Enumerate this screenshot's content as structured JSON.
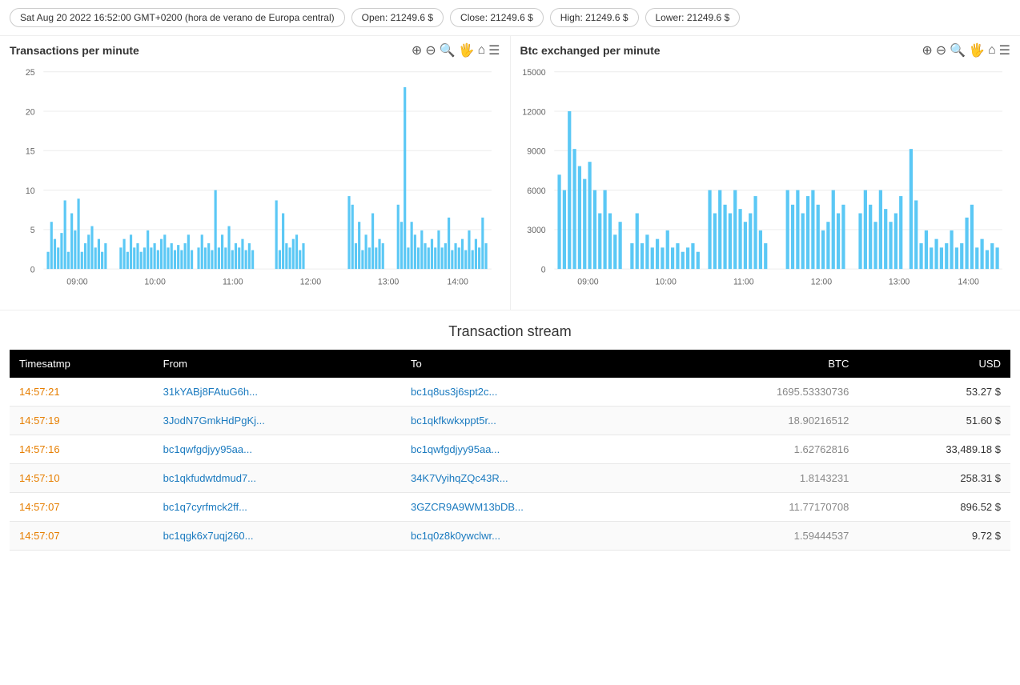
{
  "topBar": {
    "datetime": "Sat Aug 20 2022 16:52:00 GMT+0200 (hora de verano de Europa central)",
    "open": "Open: 21249.6 $",
    "close": "Close: 21249.6 $",
    "high": "High: 21249.6 $",
    "lower": "Lower: 21249.6 $"
  },
  "charts": {
    "left": {
      "title": "Transactions per minute",
      "yLabels": [
        "25",
        "20",
        "15",
        "10",
        "5",
        "0"
      ],
      "xLabels": [
        "09:00",
        "10:00",
        "11:00",
        "12:00",
        "13:00",
        "14:00"
      ]
    },
    "right": {
      "title": "Btc exchanged per minute",
      "yLabels": [
        "15000",
        "12000",
        "9000",
        "6000",
        "3000",
        "0"
      ],
      "xLabels": [
        "09:00",
        "10:00",
        "11:00",
        "12:00",
        "13:00",
        "14:00"
      ]
    }
  },
  "transactionStream": {
    "title": "Transaction stream",
    "columns": [
      "Timesatmp",
      "From",
      "To",
      "BTC",
      "USD"
    ],
    "rows": [
      {
        "time": "14:57:21",
        "from": "31kYABj8FAtuG6h...",
        "fromFull": "31kYABj8FAtuG6h...",
        "to": "bc1q8us3j6spt2c...",
        "toFull": "bc1q8us3j6spt2c...",
        "btc": "1695.53330736",
        "usd": "53.27 $"
      },
      {
        "time": "14:57:19",
        "from": "3JodN7GmkHdPgKj...",
        "fromFull": "3JodN7GmkHdPgKj...",
        "to": "bc1qkfkwkxppt5r...",
        "toFull": "bc1qkfkwkxppt5r...",
        "btc": "18.90216512",
        "usd": "51.60 $"
      },
      {
        "time": "14:57:16",
        "from": "bc1qwfgdjyy95aa...",
        "fromFull": "bc1qwfgdjyy95aa...",
        "to": "bc1qwfgdjyy95aa...",
        "toFull": "bc1qwfgdjyy95aa...",
        "btc": "1.62762816",
        "usd": "33,489.18 $"
      },
      {
        "time": "14:57:10",
        "from": "bc1qkfudwtdmud7...",
        "fromFull": "bc1qkfudwtdmud7...",
        "to": "34K7VyihqZQc43R...",
        "toFull": "34K7VyihqZQc43R...",
        "btc": "1.8143231",
        "usd": "258.31 $"
      },
      {
        "time": "14:57:07",
        "from": "bc1q7cyrfmck2ff...",
        "fromFull": "bc1q7cyrfmck2ff...",
        "to": "3GZCR9A9WM13bDB...",
        "toFull": "3GZCR9A9WM13bDB...",
        "btc": "11.77170708",
        "usd": "896.52 $"
      },
      {
        "time": "14:57:07",
        "from": "bc1qgk6x7uqj260...",
        "fromFull": "bc1qgk6x7uqj260...",
        "to": "bc1q0z8k0ywclwr...",
        "toFull": "bc1q0z8k0ywclwr...",
        "btc": "1.59444537",
        "usd": "9.72 $"
      }
    ]
  },
  "icons": {
    "zoom_in": "⊕",
    "zoom_out": "⊖",
    "magnifier": "🔍",
    "pan": "✋",
    "home": "🏠",
    "menu": "☰"
  }
}
